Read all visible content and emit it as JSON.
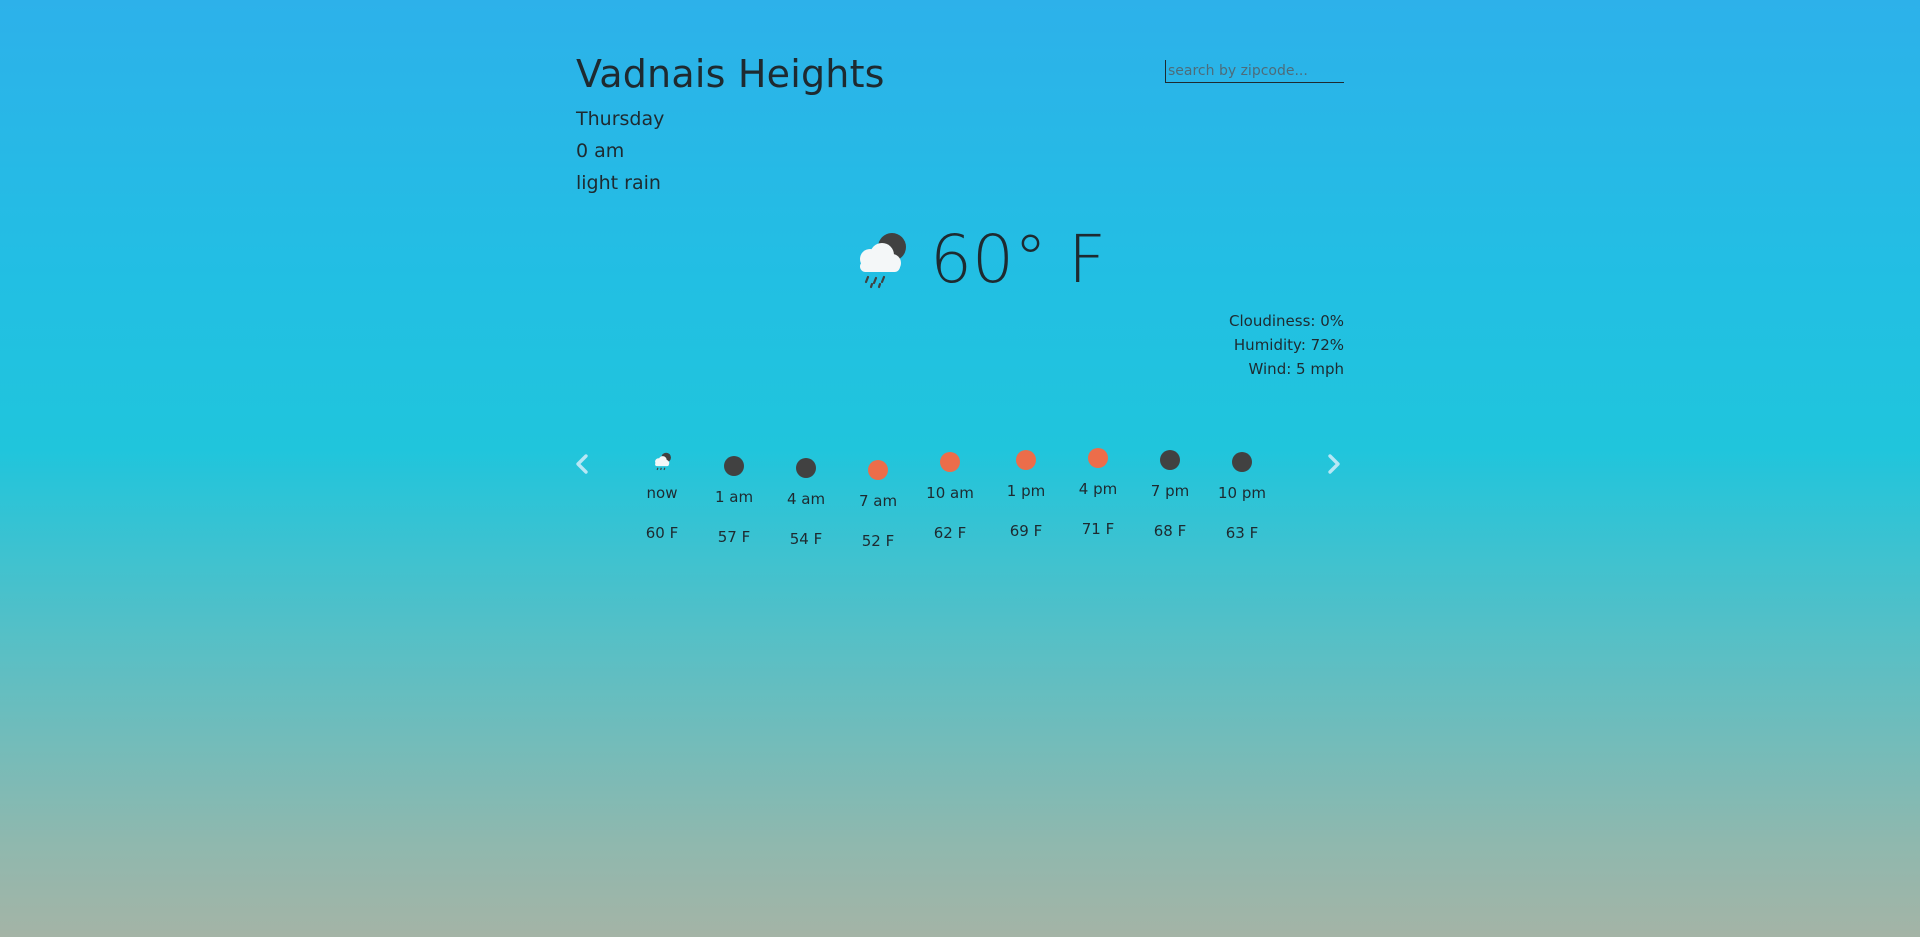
{
  "location": {
    "city": "Vadnais Heights",
    "day": "Thursday",
    "time": "0 am",
    "condition": "light rain"
  },
  "search": {
    "placeholder": "search by zipcode..."
  },
  "current": {
    "icon": "rain-cloud-night-icon",
    "temperature": "60° F"
  },
  "details": {
    "cloudiness": "Cloudiness: 0%",
    "humidity": "Humidity: 72%",
    "wind": "Wind: 5 mph"
  },
  "colors": {
    "dark_dot": "#414141",
    "orange_dot": "#ec6d4a",
    "arrow": "#b7e7f5"
  },
  "hourly": [
    {
      "label": "now",
      "temp": "60 F",
      "icon": "rain-cloud-night-icon"
    },
    {
      "label": "1 am",
      "temp": "57 F",
      "icon": "moon-dot-icon"
    },
    {
      "label": "4 am",
      "temp": "54 F",
      "icon": "moon-dot-icon"
    },
    {
      "label": "7 am",
      "temp": "52 F",
      "icon": "sun-dot-icon"
    },
    {
      "label": "10 am",
      "temp": "62 F",
      "icon": "sun-dot-icon"
    },
    {
      "label": "1 pm",
      "temp": "69 F",
      "icon": "sun-dot-icon"
    },
    {
      "label": "4 pm",
      "temp": "71 F",
      "icon": "sun-dot-icon"
    },
    {
      "label": "7 pm",
      "temp": "68 F",
      "icon": "moon-dot-icon"
    },
    {
      "label": "10 pm",
      "temp": "63 F",
      "icon": "moon-dot-icon"
    }
  ]
}
